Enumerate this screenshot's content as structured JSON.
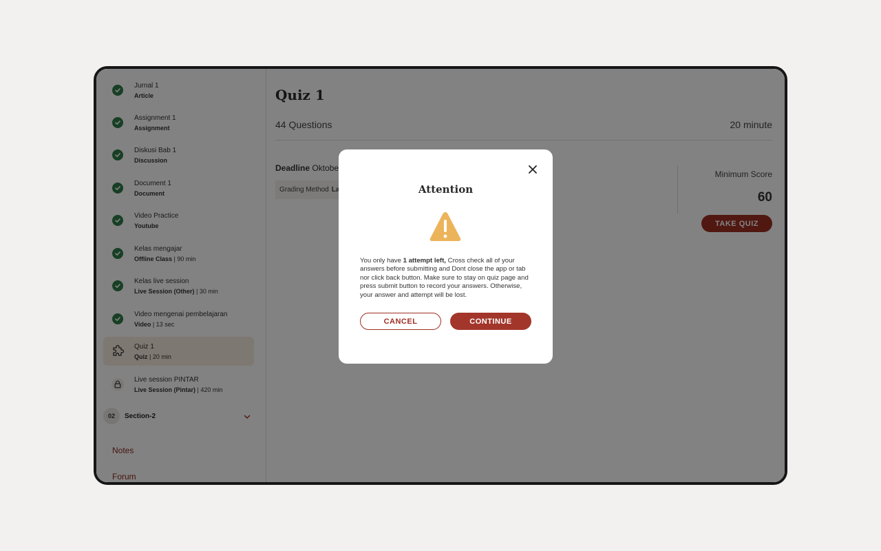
{
  "sidebar": {
    "lessons": [
      {
        "title": "Jurnal 1",
        "type": "Article",
        "extra": "",
        "status": "done"
      },
      {
        "title": "Assignment 1",
        "type": "Assignment",
        "extra": "",
        "status": "done"
      },
      {
        "title": "Diskusi Bab 1",
        "type": "Discussion",
        "extra": "",
        "status": "done"
      },
      {
        "title": "Document 1",
        "type": "Document",
        "extra": "",
        "status": "done"
      },
      {
        "title": "Video Practice",
        "type": "Youtube",
        "extra": "",
        "status": "done"
      },
      {
        "title": "Kelas mengajar",
        "type": "Offline Class",
        "extra": " | 90 min",
        "status": "done"
      },
      {
        "title": "Kelas live session",
        "type": "Live Session (Other)",
        "extra": " | 30 min",
        "status": "done"
      },
      {
        "title": "Video mengenai pembelajaran",
        "type": "Video",
        "extra": " | 13 sec",
        "status": "done"
      },
      {
        "title": "Quiz 1",
        "type": "Quiz",
        "extra": " | 20 min",
        "status": "active"
      },
      {
        "title": "Live session PINTAR",
        "type": "Live Session (Pintar)",
        "extra": " | 420 min",
        "status": "locked"
      }
    ],
    "section": {
      "number": "02",
      "label": "Section-2"
    },
    "links": {
      "notes": "Notes",
      "forum": "Forum"
    }
  },
  "main": {
    "title": "Quiz 1",
    "questions": "44 Questions",
    "duration": "20 minute",
    "deadline_label": "Deadline",
    "deadline_value": " Oktobe",
    "grading_label": "Grading Method",
    "grading_value": "La",
    "min_score_label": "Minimum Score",
    "min_score_value": "60",
    "take_quiz": "TAKE QUIZ"
  },
  "modal": {
    "title": "Attention",
    "body_pre": "You only have ",
    "body_bold": "1 attempt left,",
    "body_post": " Cross check all of your answers before submitting and Dont close the app or tab nor click back button. Make sure to stay on quiz page and press submit button to record your answers. Otherwise, your answer and attempt will be lost.",
    "cancel": "CANCEL",
    "continue": "CONTINUE"
  },
  "colors": {
    "accent": "#9e2f23",
    "success": "#2f7d4a",
    "warning": "#ecb45a",
    "active_item_bg": "#f7ebdf"
  }
}
